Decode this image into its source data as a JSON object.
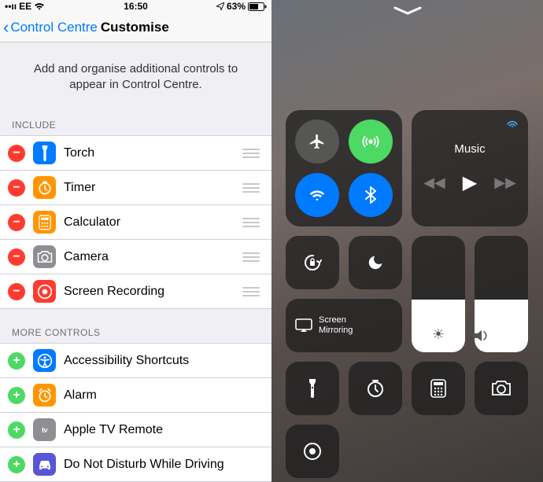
{
  "statusBar": {
    "carrier": "EE",
    "time": "16:50",
    "batteryPct": "63%"
  },
  "nav": {
    "backLabel": "Control Centre",
    "title": "Customise"
  },
  "description": "Add and organise additional controls to appear in Control Centre.",
  "includeHeader": "INCLUDE",
  "includeItems": [
    {
      "label": "Torch",
      "iconColor": "#007aff"
    },
    {
      "label": "Timer",
      "iconColor": "#ff9500"
    },
    {
      "label": "Calculator",
      "iconColor": "#ff9500"
    },
    {
      "label": "Camera",
      "iconColor": "#8e8e93"
    },
    {
      "label": "Screen Recording",
      "iconColor": "#ff3b30"
    }
  ],
  "moreHeader": "MORE CONTROLS",
  "moreItems": [
    {
      "label": "Accessibility Shortcuts",
      "iconColor": "#007aff"
    },
    {
      "label": "Alarm",
      "iconColor": "#ff9500"
    },
    {
      "label": "Apple TV Remote",
      "iconColor": "#8e8e93"
    },
    {
      "label": "Do Not Disturb While Driving",
      "iconColor": "#5856d6"
    }
  ],
  "controlCentre": {
    "musicLabel": "Music",
    "screenMirroring": "Screen\nMirroring",
    "brightnessLevel": 45,
    "volumeLevel": 45
  }
}
